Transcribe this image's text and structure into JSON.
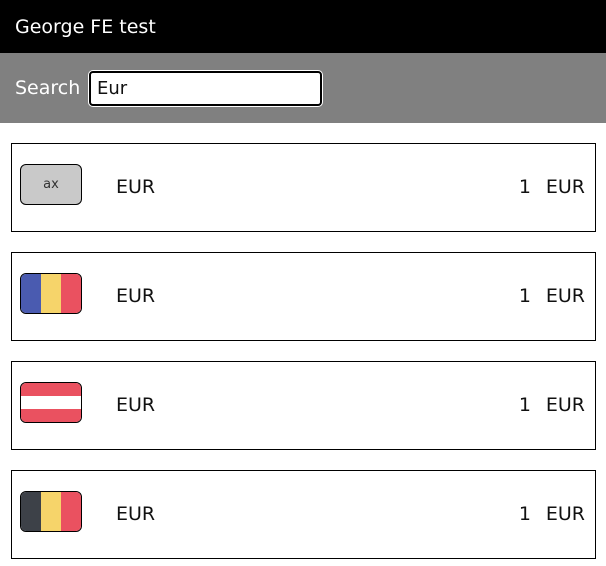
{
  "app": {
    "title": "George FE test"
  },
  "search": {
    "label": "Search",
    "value": "Eur"
  },
  "rows": [
    {
      "flag_type": "text",
      "flag_text": "ax",
      "code": "EUR",
      "amount": "1",
      "currency": "EUR"
    },
    {
      "flag_type": "vertical",
      "flag_colors": [
        "#4a5bb0",
        "#f6d46a",
        "#ea5160"
      ],
      "code": "EUR",
      "amount": "1",
      "currency": "EUR"
    },
    {
      "flag_type": "horizontal",
      "flag_colors": [
        "#ea5160",
        "#ffffff",
        "#ea5160"
      ],
      "code": "EUR",
      "amount": "1",
      "currency": "EUR"
    },
    {
      "flag_type": "vertical",
      "flag_colors": [
        "#3d4148",
        "#f6d46a",
        "#ea5160"
      ],
      "code": "EUR",
      "amount": "1",
      "currency": "EUR"
    }
  ]
}
